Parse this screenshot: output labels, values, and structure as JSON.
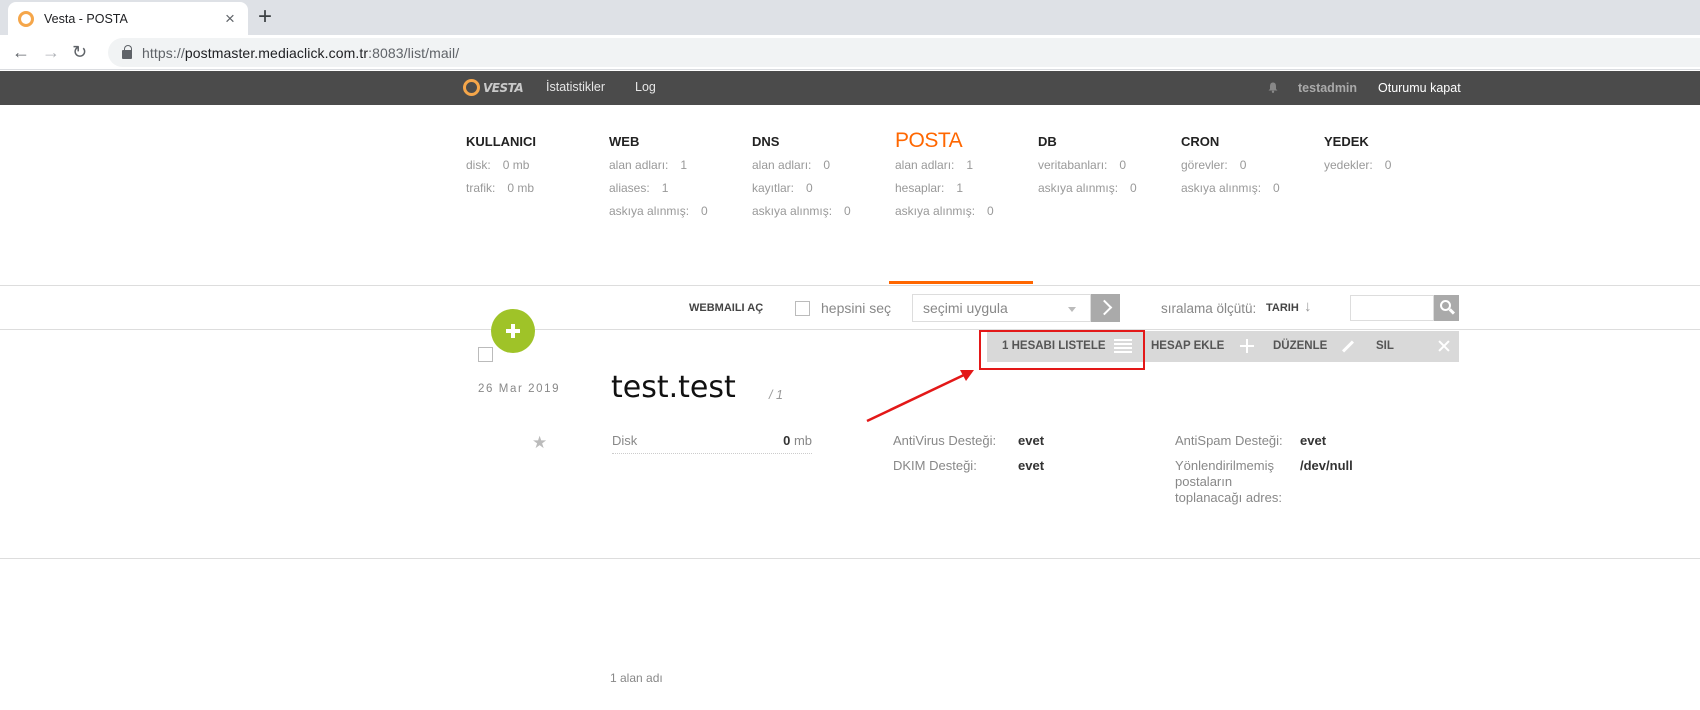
{
  "browser": {
    "tab_title": "Vesta - POSTA",
    "url_prefix": "https://",
    "url_host": "postmaster.mediaclick.com.tr",
    "url_rest": ":8083/list/mail/"
  },
  "topbar": {
    "logo_text": "VESTA",
    "nav": [
      "İstatistikler",
      "Log"
    ],
    "user": "testadmin",
    "logout": "Oturumu kapat"
  },
  "stats": {
    "kullanici": {
      "title": "KULLANICI",
      "rows": [
        [
          "disk:",
          "0 mb"
        ],
        [
          "trafik:",
          "0 mb"
        ]
      ]
    },
    "web": {
      "title": "WEB",
      "rows": [
        [
          "alan adları:",
          "1"
        ],
        [
          "aliases:",
          "1"
        ],
        [
          "askıya alınmış:",
          "0"
        ]
      ]
    },
    "dns": {
      "title": "DNS",
      "rows": [
        [
          "alan adları:",
          "0"
        ],
        [
          "kayıtlar:",
          "0"
        ],
        [
          "askıya alınmış:",
          "0"
        ]
      ]
    },
    "posta": {
      "title": "POSTA",
      "rows": [
        [
          "alan adları:",
          "1"
        ],
        [
          "hesaplar:",
          "1"
        ],
        [
          "askıya alınmış:",
          "0"
        ]
      ]
    },
    "db": {
      "title": "DB",
      "rows": [
        [
          "veritabanları:",
          "0"
        ],
        [
          "askıya alınmış:",
          "0"
        ]
      ]
    },
    "cron": {
      "title": "CRON",
      "rows": [
        [
          "görevler:",
          "0"
        ],
        [
          "askıya alınmış:",
          "0"
        ]
      ]
    },
    "yedek": {
      "title": "YEDEK",
      "rows": [
        [
          "yedekler:",
          "0"
        ]
      ]
    }
  },
  "controls": {
    "webmail": "WEBMAILI AÇ",
    "select_all": "hepsini seç",
    "bulk_action": "seçimi uygula",
    "sort_label": "sıralama ölçütü:",
    "sort_value": "TARIH",
    "sort_arrow": "↓"
  },
  "actions": {
    "list_accounts": "1 HESABI LISTELE",
    "add_account": "HESAP EKLE",
    "edit": "DÜZENLE",
    "delete": "SIL"
  },
  "record": {
    "date": "26 Mar 2019",
    "domain": "test.test",
    "count": "/ 1",
    "disk_label": "Disk",
    "disk_value": "0",
    "disk_unit": "mb",
    "antivirus_label": "AntiVirus Desteği:",
    "antivirus_value": "evet",
    "dkim_label": "DKIM Desteği:",
    "dkim_value": "evet",
    "antispam_label": "AntiSpam Desteği:",
    "antispam_value": "evet",
    "catchall_label": "Yönlendirilmemiş postaların toplanacağı adres:",
    "catchall_value": "/dev/null"
  },
  "footer": {
    "count": "1 alan adı"
  },
  "colors": {
    "accent": "#ff6701",
    "add_button": "#9fc328",
    "annotation": "#e31818",
    "topbar": "#4b4b4b"
  }
}
